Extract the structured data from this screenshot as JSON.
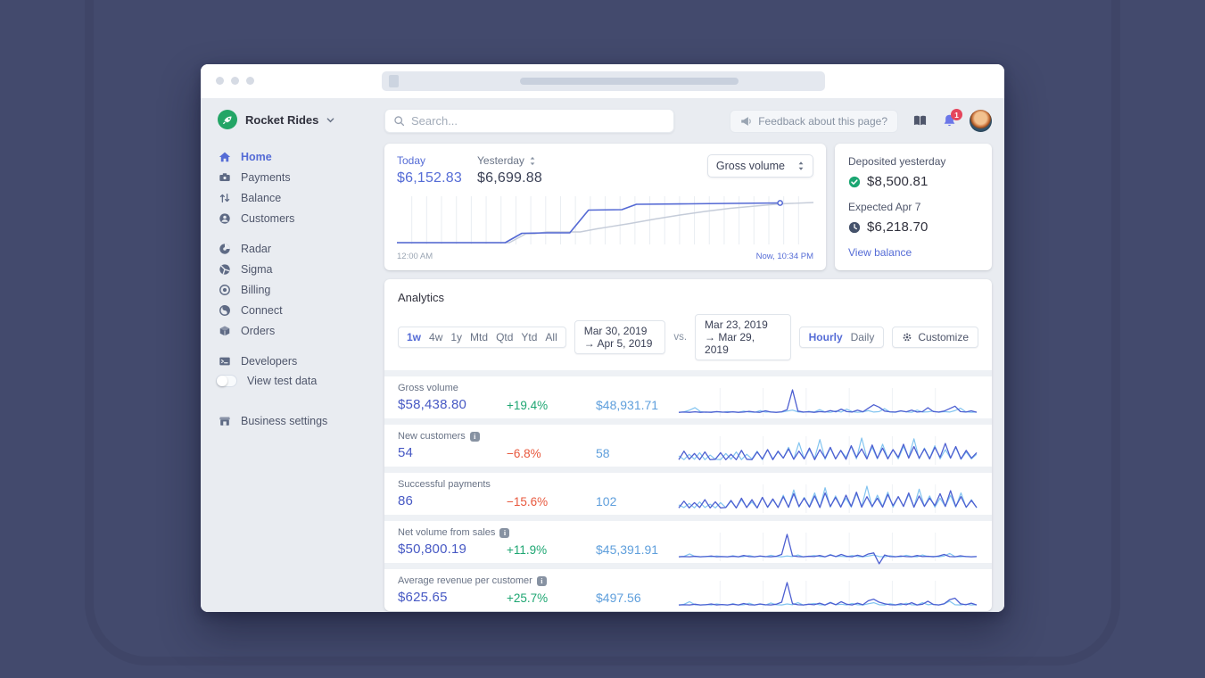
{
  "colors": {
    "accent": "#556cd6",
    "positive": "#1ea672",
    "negative": "#e8583d",
    "previous_period": "#5f9fdc",
    "spark_current": "#4d5fd1",
    "spark_previous": "#82c4f0",
    "today_line": "#5469d4",
    "yesterday_line": "#c5ccd9"
  },
  "sidebar": {
    "account_name": "Rocket Rides",
    "nav_main": [
      {
        "label": "Home",
        "active": true
      },
      {
        "label": "Payments",
        "active": false
      },
      {
        "label": "Balance",
        "active": false
      },
      {
        "label": "Customers",
        "active": false
      }
    ],
    "nav_products": [
      {
        "label": "Radar"
      },
      {
        "label": "Sigma"
      },
      {
        "label": "Billing"
      },
      {
        "label": "Connect"
      },
      {
        "label": "Orders"
      }
    ],
    "nav_dev": [
      {
        "label": "Developers"
      }
    ],
    "toggle_label": "View test data",
    "settings_label": "Business settings"
  },
  "topbar": {
    "search_placeholder": "Search...",
    "feedback_label": "Feedback about this page?",
    "notification_count": "1"
  },
  "overview": {
    "today_label": "Today",
    "today_value": "$6,152.83",
    "yesterday_label": "Yesterday",
    "yesterday_value": "$6,699.88",
    "metric_select": "Gross volume",
    "axis_start": "12:00 AM",
    "axis_end": "Now, 10:34 PM",
    "chart": {
      "type": "line",
      "today": [
        [
          0,
          2
        ],
        [
          26,
          2
        ],
        [
          30,
          23
        ],
        [
          36,
          24
        ],
        [
          41.5,
          24
        ],
        [
          46,
          75
        ],
        [
          54,
          76
        ],
        [
          57.5,
          88
        ],
        [
          70,
          89
        ],
        [
          80,
          90
        ],
        [
          92,
          91
        ]
      ],
      "yesterday": [
        [
          0,
          2
        ],
        [
          27,
          2
        ],
        [
          31,
          22
        ],
        [
          33,
          22
        ],
        [
          36,
          26
        ],
        [
          44,
          26
        ],
        [
          48,
          33
        ],
        [
          56,
          45
        ],
        [
          62,
          55
        ],
        [
          68,
          64
        ],
        [
          74,
          72
        ],
        [
          80,
          79
        ],
        [
          86,
          84
        ],
        [
          92,
          89
        ],
        [
          100,
          92
        ]
      ],
      "gridlines": 27
    }
  },
  "deposits": {
    "deposited_label": "Deposited yesterday",
    "deposited_value": "$8,500.81",
    "expected_label": "Expected Apr 7",
    "expected_value": "$6,218.70",
    "link_label": "View balance"
  },
  "analytics": {
    "title": "Analytics",
    "range_options": [
      "1w",
      "4w",
      "1y",
      "Mtd",
      "Qtd",
      "Ytd",
      "All"
    ],
    "range_active": "1w",
    "range_primary": "Mar 30, 2019 →  Apr 5, 2019",
    "vs_label": "vs.",
    "range_compare": "Mar 23, 2019 → Mar 29, 2019",
    "granularity_options": [
      "Hourly",
      "Daily"
    ],
    "granularity_active": "Hourly",
    "customize_label": "Customize",
    "rows": [
      {
        "label": "Gross volume",
        "has_info": false,
        "value": "$58,438.80",
        "delta": "+19.4%",
        "trend": "positive",
        "previous": "$48,931.71",
        "spark": {
          "current": [
            3,
            4,
            3,
            5,
            3,
            4,
            3,
            6,
            4,
            3,
            5,
            3,
            4,
            7,
            4,
            3,
            9,
            4,
            3,
            5,
            14,
            95,
            8,
            4,
            5,
            3,
            6,
            4,
            10,
            5,
            16,
            6,
            4,
            12,
            5,
            20,
            34,
            24,
            8,
            5,
            4,
            9,
            5,
            12,
            4,
            6,
            22,
            6,
            4,
            8,
            18,
            28,
            6,
            4,
            9,
            3
          ],
          "previous": [
            3,
            5,
            12,
            22,
            6,
            3,
            4,
            5,
            3,
            6,
            4,
            3,
            8,
            4,
            3,
            10,
            4,
            5,
            3,
            4,
            8,
            12,
            5,
            3,
            7,
            4,
            14,
            5,
            3,
            9,
            4,
            16,
            6,
            3,
            5,
            10,
            4,
            6,
            18,
            4,
            3,
            8,
            5,
            3,
            12,
            4,
            5,
            8,
            3,
            6,
            4,
            10,
            20,
            5,
            3,
            4
          ]
        }
      },
      {
        "label": "New customers",
        "has_info": true,
        "value": "54",
        "delta": "−6.8%",
        "trend": "negative",
        "previous": "58",
        "spark": {
          "current": [
            4,
            26,
            5,
            20,
            4,
            24,
            4,
            5,
            22,
            4,
            18,
            4,
            28,
            5,
            4,
            24,
            6,
            30,
            4,
            26,
            8,
            32,
            5,
            26,
            6,
            34,
            4,
            30,
            8,
            36,
            6,
            28,
            5,
            40,
            10,
            32,
            6,
            42,
            8,
            34,
            6,
            30,
            10,
            44,
            8,
            38,
            8,
            32,
            6,
            36,
            10,
            46,
            8,
            38,
            6,
            28,
            8,
            22
          ],
          "previous": [
            14,
            4,
            18,
            5,
            22,
            4,
            16,
            5,
            4,
            20,
            5,
            24,
            4,
            18,
            6,
            26,
            4,
            30,
            6,
            24,
            8,
            36,
            5,
            48,
            6,
            30,
            8,
            56,
            5,
            34,
            6,
            28,
            10,
            38,
            6,
            60,
            8,
            36,
            6,
            44,
            8,
            30,
            6,
            38,
            10,
            58,
            6,
            34,
            8,
            40,
            6,
            30,
            8,
            36,
            5,
            24,
            6,
            18
          ]
        }
      },
      {
        "label": "Successful payments",
        "has_info": false,
        "value": "86",
        "delta": "−15.6%",
        "trend": "negative",
        "previous": "102",
        "spark": {
          "current": [
            4,
            22,
            4,
            18,
            5,
            26,
            4,
            20,
            4,
            5,
            24,
            4,
            30,
            5,
            26,
            4,
            32,
            6,
            28,
            5,
            34,
            6,
            42,
            8,
            30,
            6,
            36,
            5,
            44,
            8,
            32,
            6,
            38,
            8,
            46,
            6,
            34,
            8,
            30,
            6,
            40,
            10,
            34,
            8,
            44,
            6,
            36,
            8,
            30,
            10,
            42,
            8,
            50,
            8,
            34,
            6,
            24,
            5
          ],
          "previous": [
            12,
            5,
            16,
            4,
            20,
            5,
            14,
            4,
            18,
            5,
            22,
            4,
            26,
            6,
            20,
            4,
            32,
            5,
            26,
            6,
            38,
            5,
            52,
            6,
            32,
            8,
            44,
            5,
            58,
            6,
            36,
            8,
            30,
            6,
            42,
            8,
            62,
            6,
            38,
            8,
            46,
            6,
            34,
            8,
            40,
            6,
            54,
            8,
            36,
            6,
            30,
            8,
            38,
            6,
            44,
            5,
            26,
            4
          ]
        }
      },
      {
        "label": "Net volume from sales",
        "has_info": true,
        "value": "$50,800.19",
        "delta": "+11.9%",
        "trend": "positive",
        "previous": "$45,391.91",
        "spark": {
          "current": [
            3,
            4,
            3,
            5,
            3,
            4,
            6,
            3,
            4,
            3,
            5,
            3,
            8,
            4,
            3,
            6,
            4,
            3,
            5,
            12,
            90,
            7,
            4,
            3,
            5,
            4,
            8,
            3,
            10,
            4,
            12,
            5,
            3,
            9,
            4,
            14,
            18,
            -24,
            10,
            4,
            3,
            6,
            4,
            3,
            8,
            4,
            5,
            3,
            6,
            12,
            4,
            3,
            7,
            4,
            3,
            4
          ],
          "previous": [
            3,
            5,
            14,
            4,
            3,
            5,
            3,
            6,
            4,
            3,
            7,
            3,
            4,
            8,
            3,
            5,
            3,
            9,
            4,
            3,
            6,
            4,
            10,
            3,
            5,
            8,
            4,
            3,
            12,
            4,
            5,
            3,
            8,
            4,
            3,
            6,
            10,
            4,
            3,
            7,
            4,
            3,
            9,
            4,
            3,
            10,
            4,
            5,
            3,
            6,
            16,
            4,
            3,
            5,
            3,
            4
          ]
        }
      },
      {
        "label": "Average revenue per customer",
        "has_info": true,
        "value": "$625.65",
        "delta": "+25.7%",
        "trend": "positive",
        "previous": "$497.56",
        "spark": {
          "current": [
            3,
            4,
            3,
            6,
            3,
            4,
            7,
            3,
            5,
            3,
            6,
            3,
            9,
            4,
            3,
            7,
            4,
            3,
            6,
            14,
            92,
            8,
            4,
            3,
            6,
            4,
            10,
            3,
            12,
            4,
            16,
            6,
            3,
            10,
            4,
            20,
            26,
            14,
            8,
            4,
            3,
            8,
            4,
            12,
            3,
            6,
            18,
            5,
            3,
            8,
            24,
            30,
            8,
            4,
            10,
            3
          ],
          "previous": [
            3,
            6,
            16,
            4,
            3,
            5,
            3,
            7,
            4,
            3,
            8,
            3,
            4,
            10,
            3,
            6,
            3,
            11,
            4,
            3,
            7,
            4,
            12,
            3,
            6,
            9,
            4,
            3,
            14,
            4,
            6,
            3,
            9,
            4,
            3,
            8,
            12,
            4,
            3,
            8,
            4,
            3,
            10,
            4,
            3,
            12,
            4,
            6,
            3,
            7,
            18,
            4,
            3,
            6,
            3,
            4
          ]
        }
      }
    ]
  }
}
